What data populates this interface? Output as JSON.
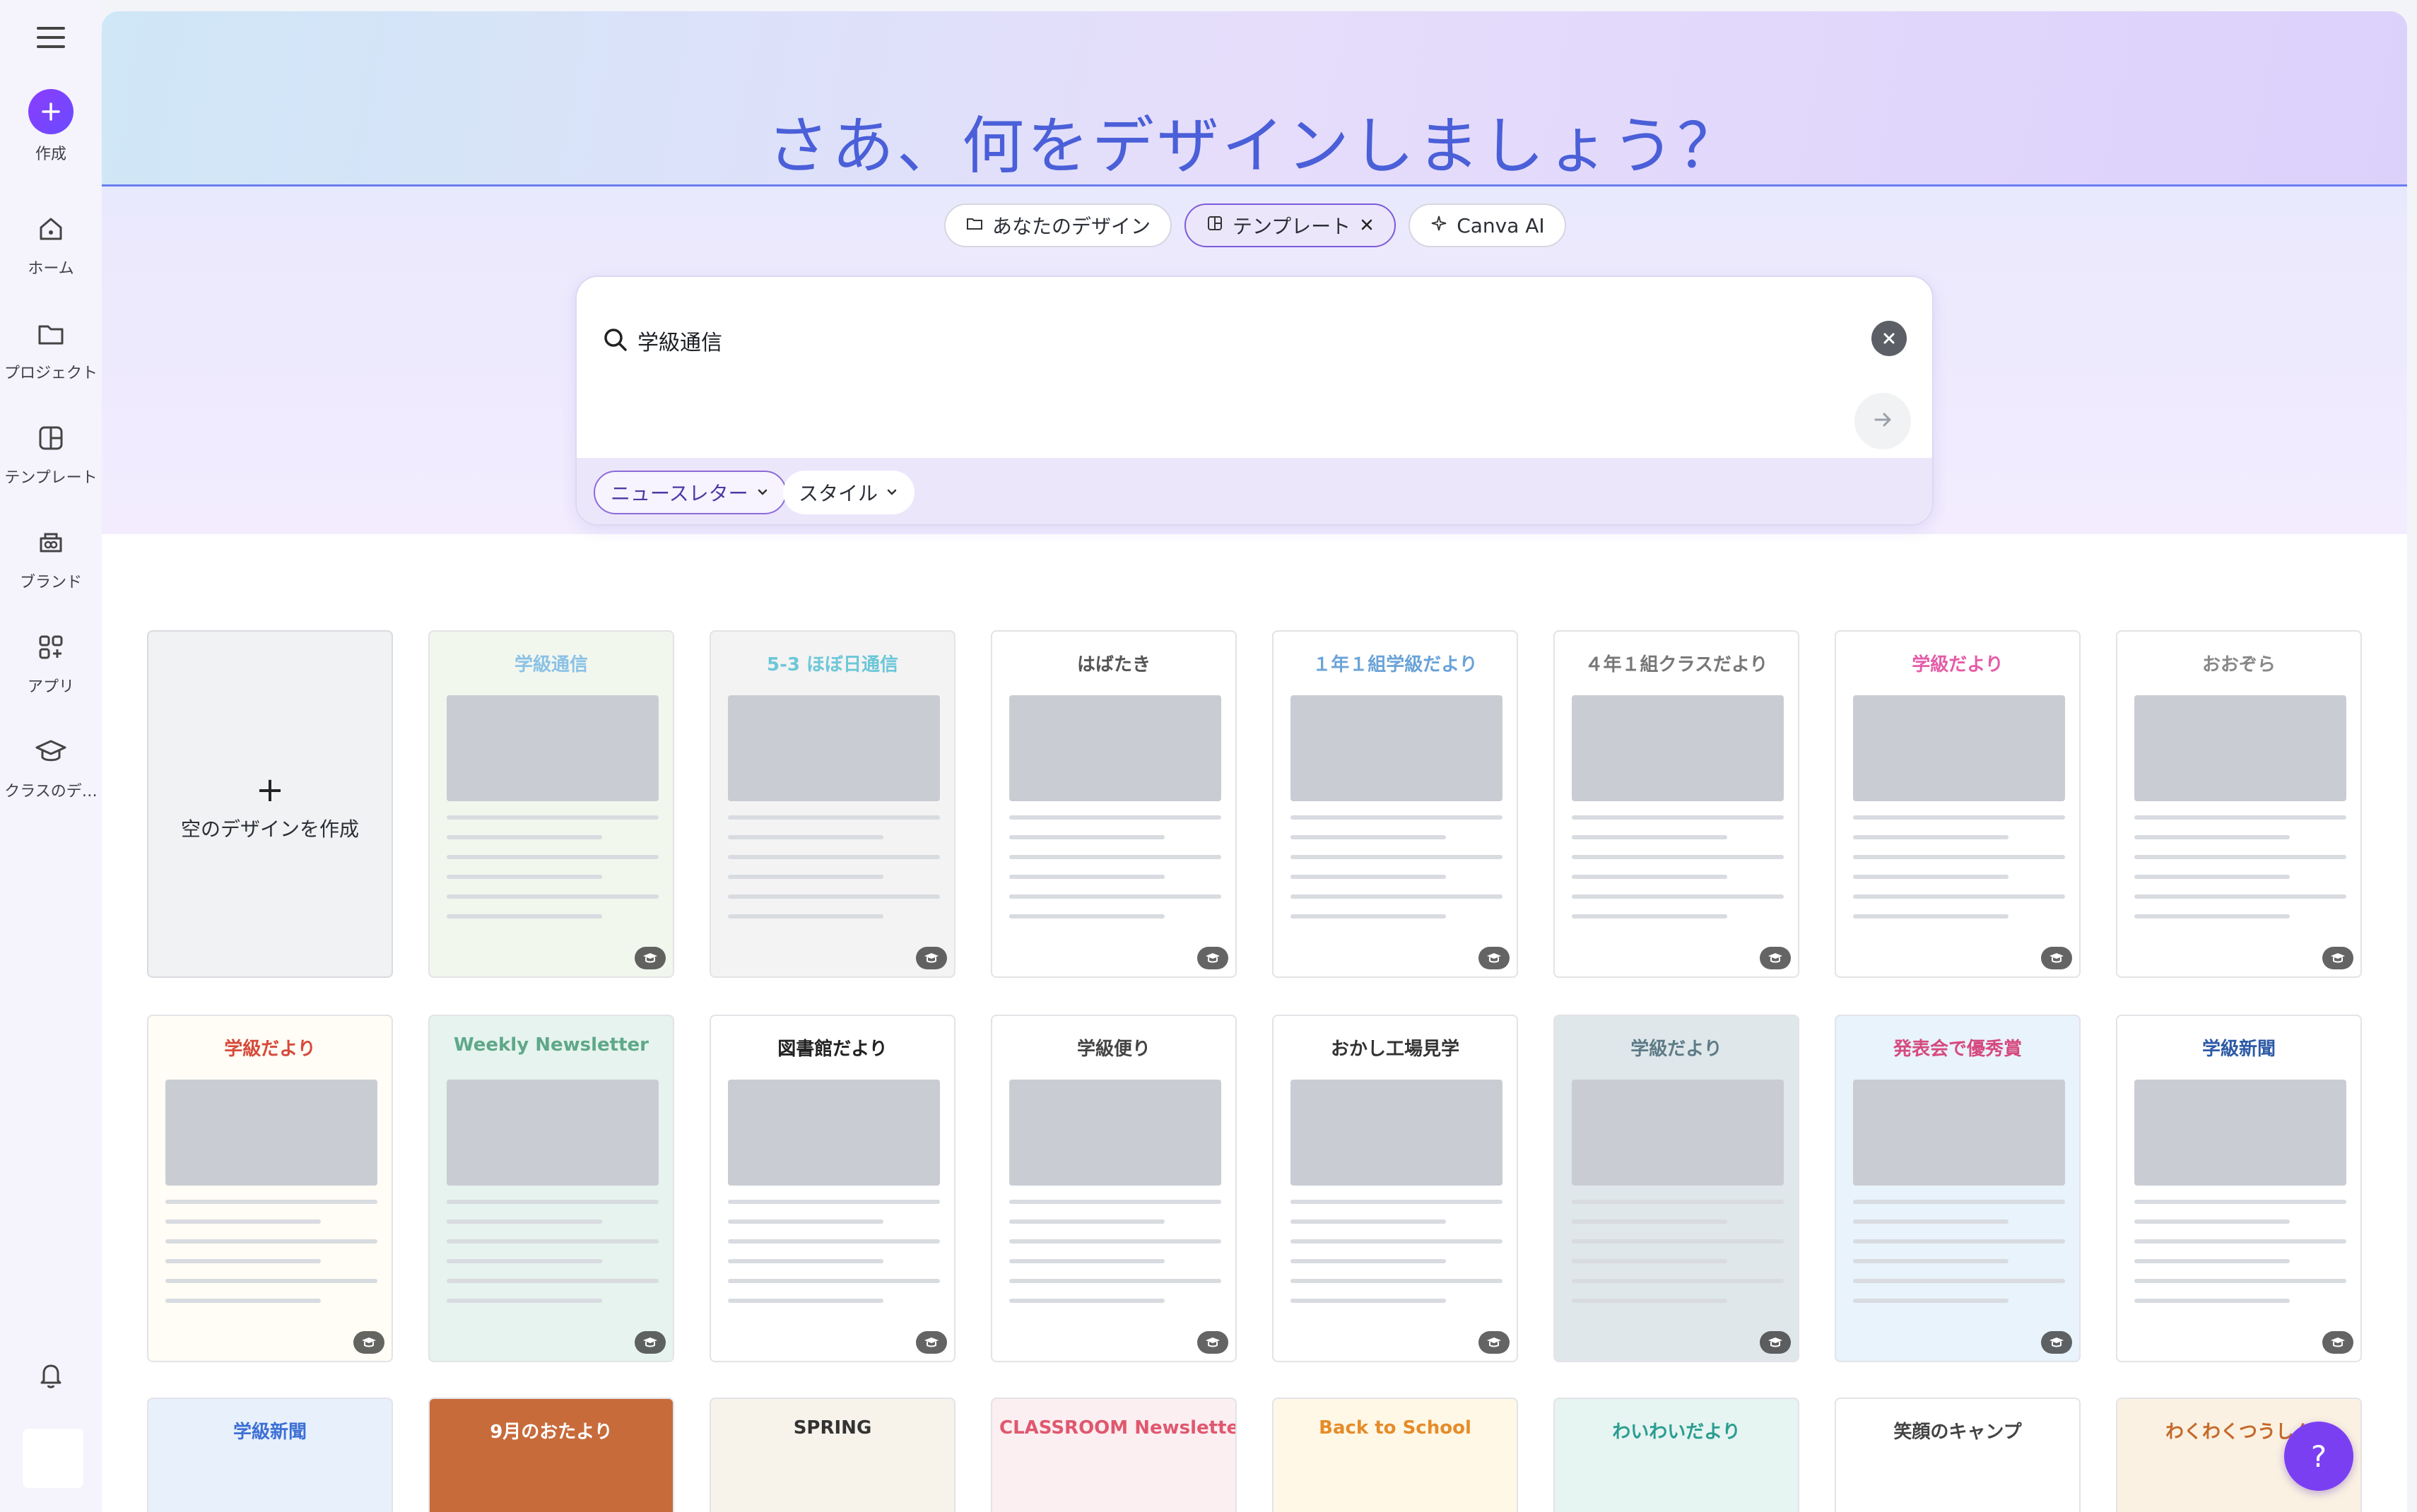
{
  "sidebar": {
    "create_label": "作成",
    "items": [
      {
        "label": "ホーム",
        "icon": "home-icon"
      },
      {
        "label": "プロジェクト",
        "icon": "folder-icon"
      },
      {
        "label": "テンプレート",
        "icon": "template-icon"
      },
      {
        "label": "ブランド",
        "icon": "brand-icon"
      },
      {
        "label": "アプリ",
        "icon": "apps-icon"
      },
      {
        "label": "クラスのデ…",
        "icon": "graduation-cap-icon"
      }
    ]
  },
  "hero": {
    "title": "さあ、何をデザインしましょう？"
  },
  "chips": [
    {
      "label": "あなたのデザイン",
      "icon": "folder-icon"
    },
    {
      "label": "テンプレート",
      "icon": "template-icon",
      "active": true
    },
    {
      "label": "Canva AI",
      "icon": "sparkle-icon"
    }
  ],
  "search": {
    "value": "学級通信"
  },
  "filters": [
    {
      "label": "ニュースレター"
    },
    {
      "label": "スタイル"
    }
  ],
  "blank_card": {
    "label": "空のデザインを作成"
  },
  "templates_row1": [
    {
      "title": "学級通信",
      "bg": "#f2f7ee",
      "accent": "#8bc2e6"
    },
    {
      "title": "5-3 ほぼ日通信",
      "bg": "#f3f3f3",
      "accent": "#6cc7d8"
    },
    {
      "title": "はばたき",
      "bg": "#ffffff",
      "accent": "#555555"
    },
    {
      "title": "１年１組学級だより",
      "bg": "#ffffff",
      "accent": "#6aa3d8"
    },
    {
      "title": "４年１組クラスだより",
      "bg": "#ffffff",
      "accent": "#777777"
    },
    {
      "title": "学級だより",
      "bg": "#ffffff",
      "accent": "#e45ca8"
    },
    {
      "title": "おおぞら",
      "bg": "#ffffff",
      "accent": "#888888"
    }
  ],
  "templates_row2": [
    {
      "title": "学級だより",
      "bg": "#fffdf5",
      "accent": "#d64a3a"
    },
    {
      "title": "Weekly Newsletter",
      "bg": "#e6f3ee",
      "accent": "#5fa88a"
    },
    {
      "title": "図書館だより",
      "bg": "#ffffff",
      "accent": "#222222"
    },
    {
      "title": "学級便り",
      "bg": "#ffffff",
      "accent": "#444444"
    },
    {
      "title": "おかし工場見学",
      "bg": "#ffffff",
      "accent": "#333333"
    },
    {
      "title": "学級だより",
      "bg": "#dfe7ea",
      "accent": "#5d7b86"
    },
    {
      "title": "発表会で優秀賞",
      "bg": "#e8f3fb",
      "accent": "#d6497f"
    },
    {
      "title": "学級新聞",
      "bg": "#ffffff",
      "accent": "#2d5aa6"
    }
  ],
  "templates_row3": [
    {
      "title": "学級新聞",
      "bg": "#e8f1fb",
      "accent": "#3d6fd6"
    },
    {
      "title": "9月のおたより",
      "bg": "#c86b3b",
      "accent": "#ffffff"
    },
    {
      "title": "SPRING",
      "bg": "#f7f2ea",
      "accent": "#333333"
    },
    {
      "title": "CLASSROOM Newsletter",
      "bg": "#fbeff2",
      "accent": "#e0586e"
    },
    {
      "title": "Back to School",
      "bg": "#fff8e6",
      "accent": "#e58c2a"
    },
    {
      "title": "わいわいだより",
      "bg": "#e6f4f2",
      "accent": "#2a9d8f"
    },
    {
      "title": "笑顔のキャンプ",
      "bg": "#ffffff",
      "accent": "#444444"
    },
    {
      "title": "わくわくつうしん",
      "bg": "#fbf1e2",
      "accent": "#c46a2a"
    }
  ],
  "help": {
    "label": "?"
  },
  "colors": {
    "brand": "#7b3ff2",
    "heroTitle": "#4a5fd8"
  }
}
